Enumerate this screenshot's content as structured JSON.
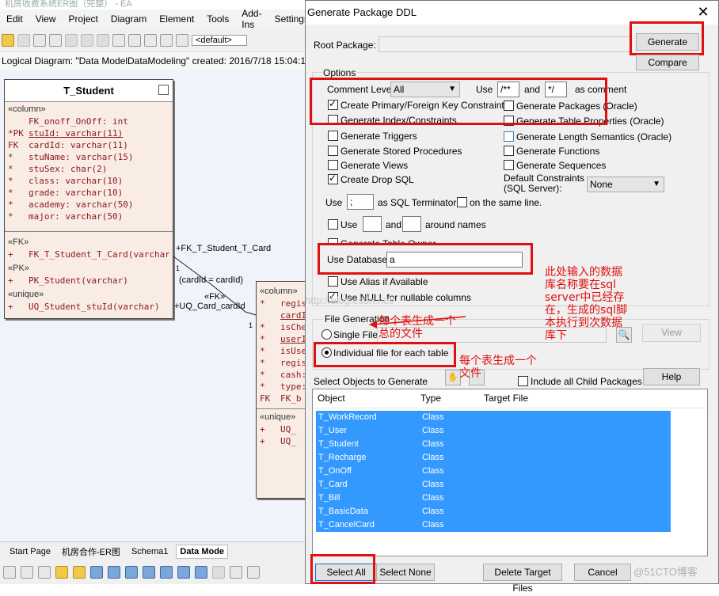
{
  "window": {
    "title": "机房收费系统ER图（完整） - EA"
  },
  "menu": [
    "Edit",
    "View",
    "Project",
    "Diagram",
    "Element",
    "Tools",
    "Add-Ins",
    "Settings"
  ],
  "toolbar": {
    "combo_value": "<default>"
  },
  "diagram_header": "Logical Diagram: \"Data ModelDataModeling\"   created: 2016/7/18 15:04:18  mo",
  "student_entity": {
    "title": "T_Student",
    "column_stereo": "«column»",
    "columns": [
      {
        "key": "",
        "text": "FK_onoff_OnOff: int"
      },
      {
        "key": "*PK",
        "text": "stuId: varchar(11)"
      },
      {
        "key": "FK",
        "text": "cardId: varchar(11)"
      },
      {
        "key": "*",
        "text": "stuName: varchar(15)"
      },
      {
        "key": "*",
        "text": "stuSex: char(2)"
      },
      {
        "key": "*",
        "text": "class: varchar(10)"
      },
      {
        "key": "*",
        "text": "grade: varchar(10)"
      },
      {
        "key": "*",
        "text": "academy: varchar(50)"
      },
      {
        "key": "*",
        "text": "major: varchar(50)"
      }
    ],
    "fk_stereo": "«FK»",
    "fk": "FK_T_Student_T_Card(varchar)",
    "pk_stereo": "«PK»",
    "pk": "PK_Student(varchar)",
    "unique_stereo": "«unique»",
    "unique": "UQ_Student_stuId(varchar)"
  },
  "card_entity": {
    "column_stereo": "«column»",
    "columns": [
      {
        "key": "*",
        "text": "regis"
      },
      {
        "key": "",
        "text": "cardI"
      },
      {
        "key": "*",
        "text": "isChe"
      },
      {
        "key": "*",
        "text": "userI"
      },
      {
        "key": "*",
        "text": "isUse"
      },
      {
        "key": "*",
        "text": "regis"
      },
      {
        "key": "*",
        "text": "cash:"
      },
      {
        "key": "*",
        "text": "type:"
      },
      {
        "key": "FK",
        "text": "FK_b"
      }
    ],
    "unique_stereo": "«unique»",
    "unique_rows": [
      "UQ_",
      "UQ_"
    ]
  },
  "connector": {
    "name": "+FK_T_Student_T_Card",
    "mult_left": "1",
    "condition": "(cardId = cardId)",
    "stereo": "«FK»",
    "uq": "+UQ_Card_cardId",
    "mult_right": "1"
  },
  "watermark": "http://blog.csdn.net/",
  "bottom_tabs": [
    "Start Page",
    "机房合作-ER图",
    "Schema1",
    "Data Mode"
  ],
  "dialog": {
    "title": "Generate Package DDL",
    "root_package_label": "Root Package:",
    "root_package_value": "",
    "generate": "Generate",
    "compare": "Compare",
    "options_label": "Options",
    "comment_level_label": "Comment Level",
    "comment_level_value": "All",
    "use_label": "Use",
    "comment_open": "/**",
    "and_label": "and",
    "comment_close": "*/",
    "as_comment": "as comment",
    "checks_left": [
      {
        "label": "Create Primary/Foreign Key Constraints",
        "checked": true
      },
      {
        "label": "Generate Index/Constraints",
        "checked": false
      },
      {
        "label": "Generate Triggers",
        "checked": false
      },
      {
        "label": "Generate Stored Procedures",
        "checked": false
      },
      {
        "label": "Generate Views",
        "checked": false
      },
      {
        "label": "Create Drop SQL",
        "checked": true
      }
    ],
    "checks_right": [
      {
        "label": "Generate Packages (Oracle)",
        "checked": false
      },
      {
        "label": "Generate Table Properties (Oracle)",
        "checked": false
      },
      {
        "label": "Generate Length Semantics (Oracle)",
        "checked": false
      },
      {
        "label": "Generate Functions",
        "checked": false
      },
      {
        "label": "Generate Sequences",
        "checked": false
      }
    ],
    "default_constraints_label": "Default Constraints\n(SQL Server):",
    "default_constraints_l1": "Default Constraints",
    "default_constraints_l2": "(SQL Server):",
    "default_constraints_value": "None",
    "terminator_use": "Use",
    "terminator_value": ";",
    "terminator_label": "as SQL Terminator",
    "same_line_label": "on the same line.",
    "names_use": "Use",
    "names_and": "and",
    "names_label": "around names",
    "table_owner_label": "Generate Table Owner",
    "use_database_label": "Use Database",
    "use_database_value": "a",
    "use_alias_label": "Use Alias if Available",
    "use_null_label": "Use NULL for nullable columns",
    "file_generation_label": "File Generation",
    "single_file": "Single File",
    "individual_file": "Individual file for each table",
    "view_btn": "View",
    "select_objects_label": "Select Objects to Generate",
    "include_child_label": "Include all Child Packages",
    "help": "Help",
    "columns": [
      "Object",
      "Type",
      "Target File"
    ],
    "objects": [
      {
        "name": "T_WorkRecord",
        "type": "Class"
      },
      {
        "name": "T_User",
        "type": "Class"
      },
      {
        "name": "T_Student",
        "type": "Class"
      },
      {
        "name": "T_Recharge",
        "type": "Class"
      },
      {
        "name": "T_OnOff",
        "type": "Class"
      },
      {
        "name": "T_Card",
        "type": "Class"
      },
      {
        "name": "T_Bill",
        "type": "Class"
      },
      {
        "name": "T_BasicData",
        "type": "Class"
      },
      {
        "name": "T_CancelCard",
        "type": "Class"
      }
    ],
    "select_all": "Select All",
    "select_none": "Select None",
    "delete_target": "Delete Target Files",
    "cancel": "Cancel"
  },
  "annotations": {
    "db_note": [
      "此处输入的数据",
      "库名称要在sql",
      "server中已经存",
      "在，生成的sql脚",
      "本执行到次数据",
      "库下"
    ],
    "single_note": [
      "每个表生成一个",
      "总的文件"
    ],
    "individual_note": [
      "每个表生成一个",
      "文件"
    ],
    "brand": "@51CTO博客"
  },
  "colors": {
    "annotation_red": "#e01010",
    "selection_blue": "#3399ff",
    "entity_fill": "#f8ece4"
  }
}
